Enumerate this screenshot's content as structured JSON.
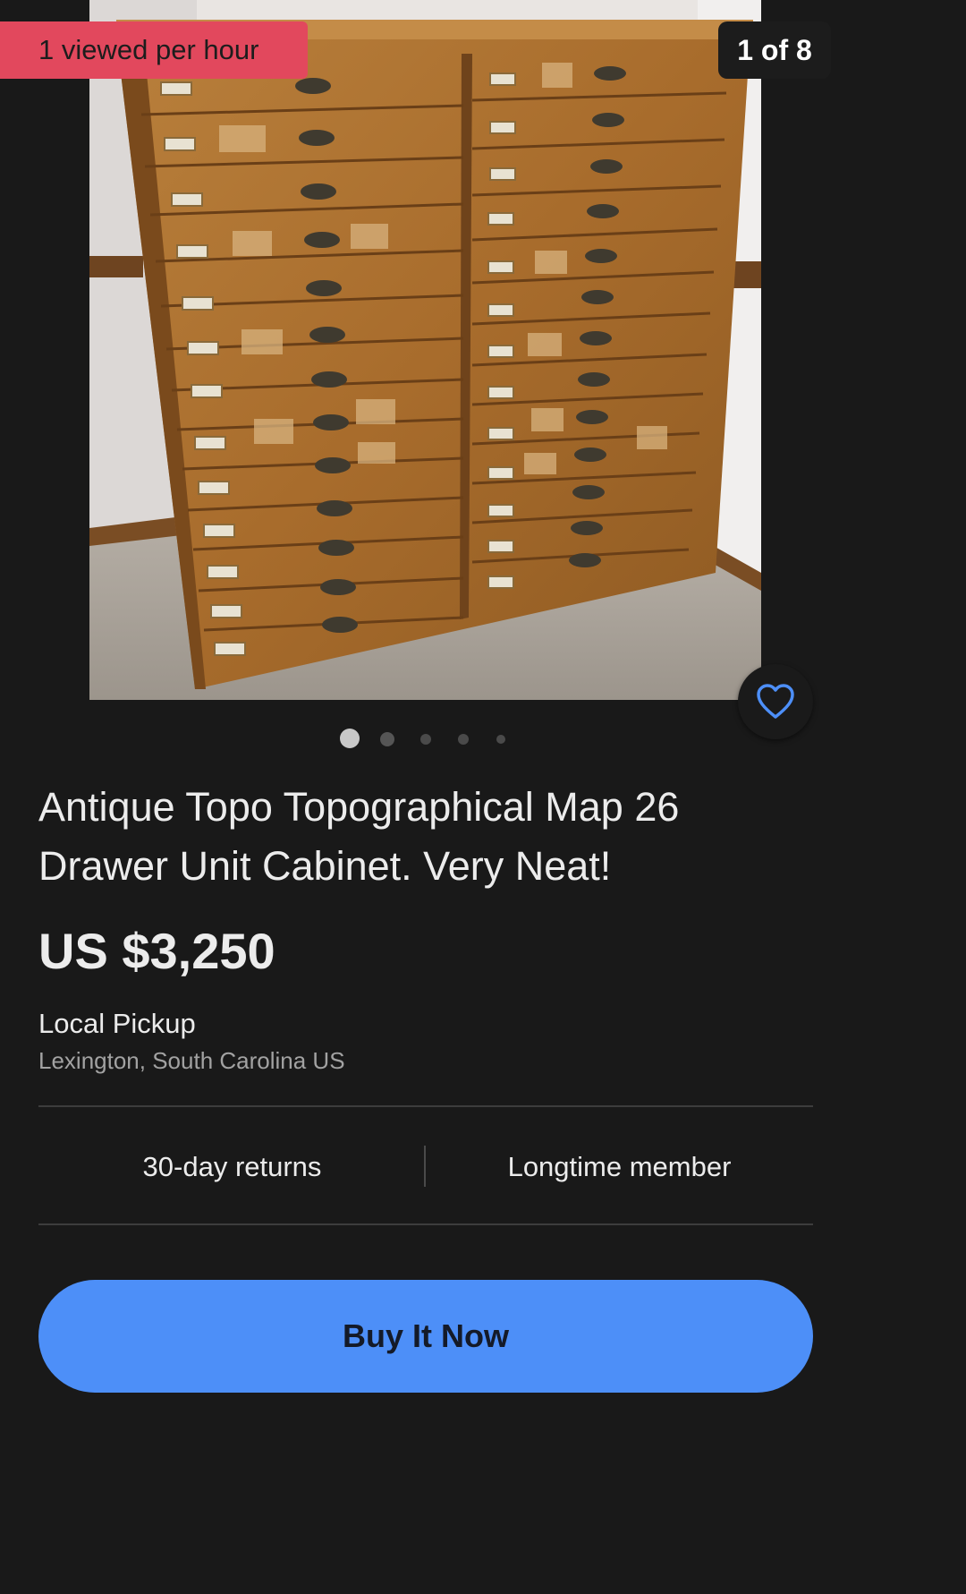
{
  "gallery": {
    "views_badge": "1 viewed per hour",
    "counter": "1 of 8",
    "image_subject": "wooden-map-drawer-cabinet",
    "dots_count": 5,
    "active_dot": 0,
    "colors": {
      "badge": "#e2485d",
      "heart": "#4d8ff8"
    }
  },
  "listing": {
    "title": "Antique Topo Topographical Map 26 Drawer Unit Cabinet. Very Neat!",
    "price": "US $3,250",
    "shipping": "Local Pickup",
    "location": "Lexington, South Carolina US"
  },
  "badges": {
    "returns": "30-day returns",
    "member": "Longtime member"
  },
  "actions": {
    "buy_now": "Buy It Now",
    "favorite_icon": "heart-icon"
  },
  "colors": {
    "background": "#191919",
    "accent": "#4d8ff8",
    "text": "#ececec",
    "muted": "#a2a2a2"
  }
}
